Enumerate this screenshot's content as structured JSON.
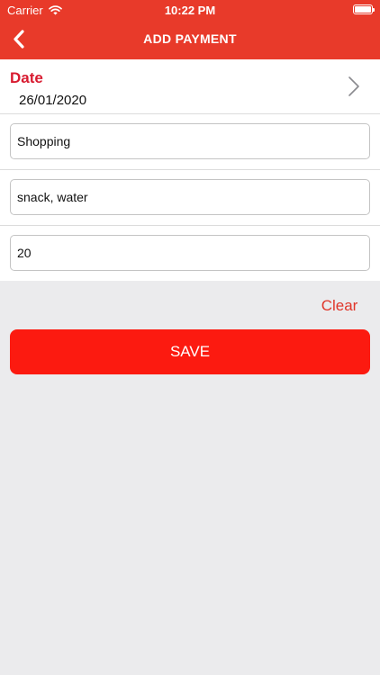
{
  "status_bar": {
    "carrier": "Carrier",
    "time": "10:22 PM",
    "icons": [
      "wifi-icon",
      "battery-icon"
    ]
  },
  "nav_bar": {
    "title": "ADD PAYMENT",
    "back_icon": "chevron-left-icon"
  },
  "form": {
    "date": {
      "label": "Date",
      "value": "26/01/2020",
      "chevron_icon": "chevron-right-icon"
    },
    "fields": [
      {
        "name": "category",
        "value": "Shopping"
      },
      {
        "name": "description",
        "value": "snack, water"
      },
      {
        "name": "amount",
        "value": "20"
      }
    ]
  },
  "actions": {
    "clear_label": "Clear",
    "save_label": "SAVE"
  },
  "colors": {
    "accent": "#e83a2a",
    "save_button": "#fc1a10",
    "date_label": "#d81b30",
    "background": "#ebebed"
  }
}
